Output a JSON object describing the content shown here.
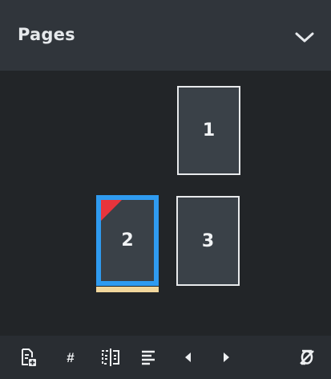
{
  "panel": {
    "title": "Pages",
    "collapse_icon": "chevron-down-icon"
  },
  "pages": [
    {
      "number": "1",
      "selected": false
    },
    {
      "number": "2",
      "selected": true,
      "corner_flag": true,
      "underline_color": "#f2d79c"
    },
    {
      "number": "3",
      "selected": false
    }
  ],
  "toolbar": {
    "items": [
      {
        "icon": "add-page-icon"
      },
      {
        "icon": "page-number-icon",
        "label": "#"
      },
      {
        "icon": "spread-toggle-icon"
      },
      {
        "icon": "align-lines-icon"
      },
      {
        "icon": "previous-page-icon"
      },
      {
        "icon": "next-page-icon"
      },
      {
        "icon": "clear-override-icon"
      }
    ]
  },
  "colors": {
    "background": "#222528",
    "header": "#30353b",
    "page_fill": "#3a4148",
    "selection": "#2f9bf0",
    "flag": "#e8343c"
  }
}
